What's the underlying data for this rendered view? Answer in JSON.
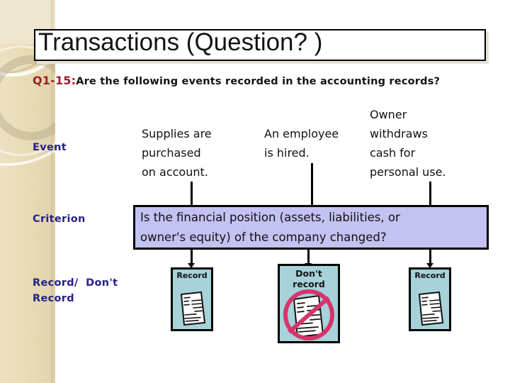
{
  "slide": {
    "title": "Transactions (Question? )",
    "question": {
      "number": "Q1-15",
      "separator": ":",
      "text": "Are the following events recorded in the accounting records?"
    },
    "row_labels": {
      "event": "Event",
      "criterion": "Criterion",
      "record": "Record/  Don't\nRecord"
    },
    "events": [
      {
        "text": "Supplies are\npurchased\non account."
      },
      {
        "text": "An employee\nis hired."
      },
      {
        "text": "Owner\nwithdraws\ncash for\npersonal use."
      }
    ],
    "criterion": {
      "text": "Is the financial position (assets, liabilities, or\nowner's equity) of the company changed?"
    },
    "outcomes": [
      {
        "caption": "Record",
        "icon": "document-icon"
      },
      {
        "caption": "Don't\nrecord",
        "icon": "document-prohibited-icon"
      },
      {
        "caption": "Record",
        "icon": "document-icon"
      }
    ],
    "colors": {
      "sidebar": "#e9dcb8",
      "criterion_fill": "#c3c2f2",
      "record_fill": "#a7d2da",
      "label_blue": "#25218c",
      "question_red": "#9e1f28",
      "prohibit_red": "#d6356b"
    }
  }
}
